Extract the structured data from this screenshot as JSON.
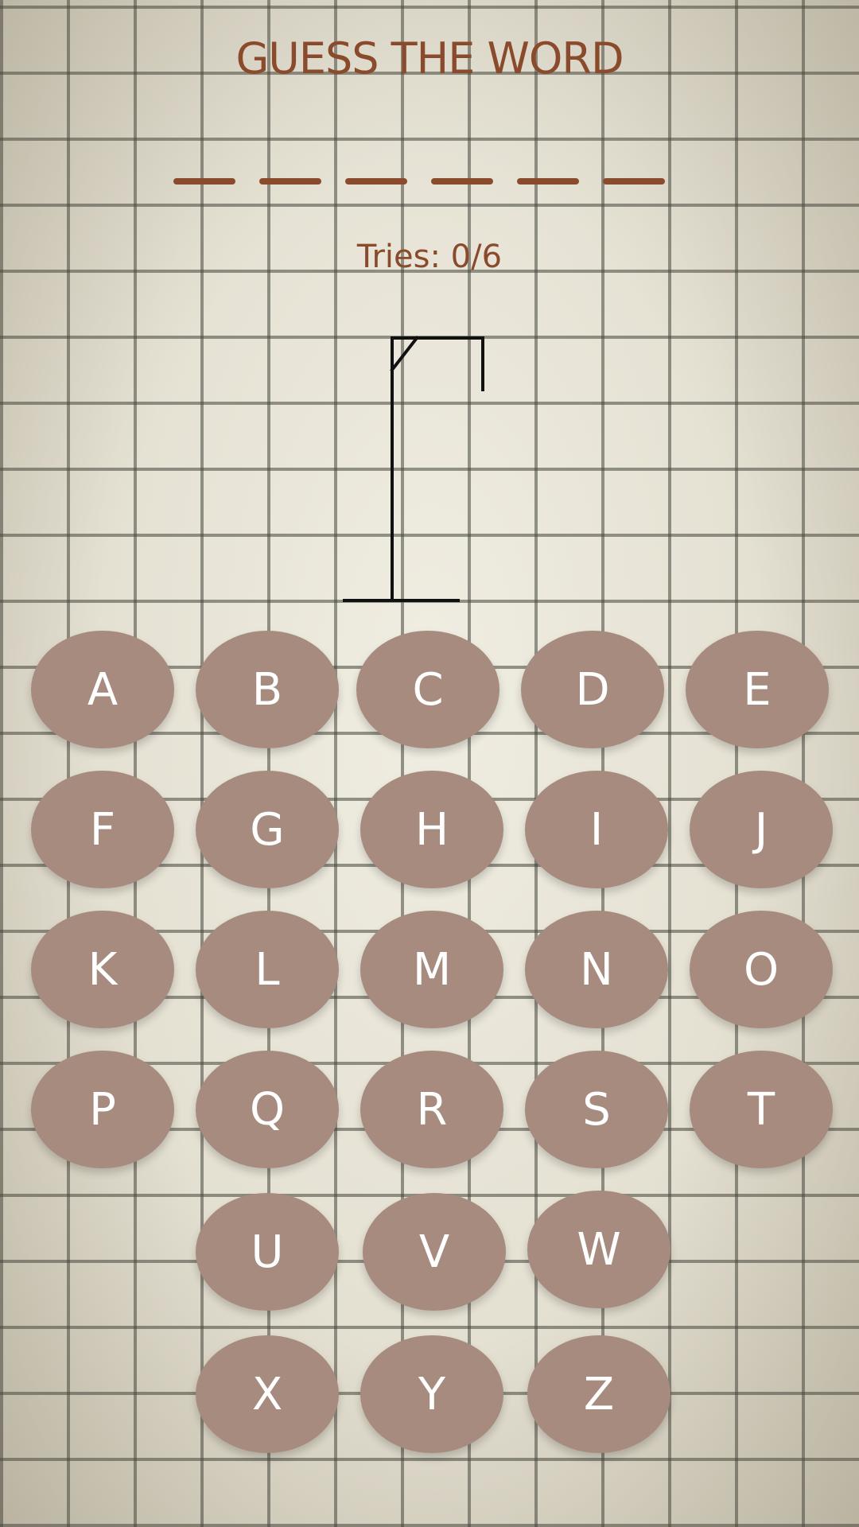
{
  "title": "GUESS THE WORD",
  "word_slots": 6,
  "tries": {
    "label": "Tries: 0/6",
    "used": 0,
    "max": 6
  },
  "colors": {
    "accent": "#8a4a2c",
    "key_fill": "#a68b7e",
    "key_text": "#ffffff",
    "gallows": "#111111"
  },
  "keyboard": {
    "rows": [
      [
        "A",
        "B",
        "C",
        "D",
        "E"
      ],
      [
        "F",
        "G",
        "H",
        "I",
        "J"
      ],
      [
        "K",
        "L",
        "M",
        "N",
        "O"
      ],
      [
        "P",
        "Q",
        "R",
        "S",
        "T"
      ],
      [
        "U",
        "V",
        "W"
      ],
      [
        "X",
        "Y",
        "Z"
      ]
    ]
  }
}
